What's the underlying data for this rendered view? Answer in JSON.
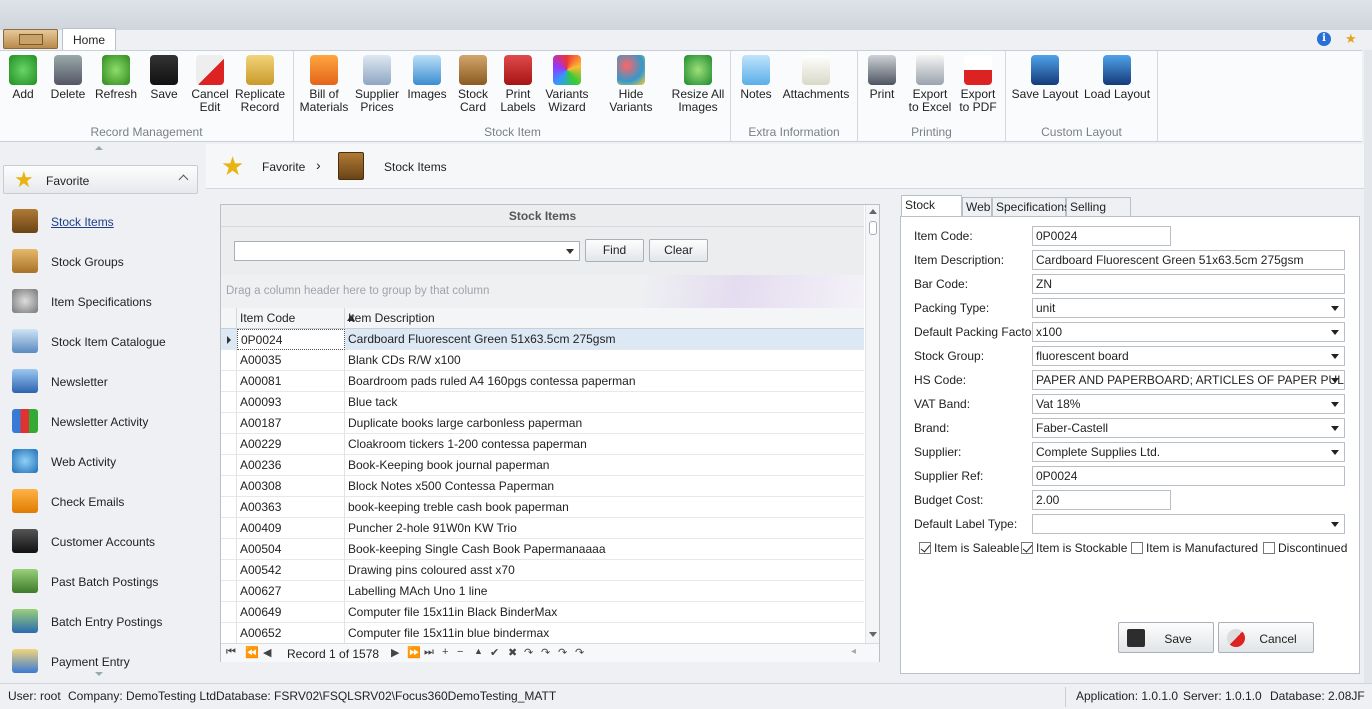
{
  "ribbon": {
    "home_tab": "Home",
    "groups": [
      {
        "caption": "Record Management",
        "buttons": [
          "Add",
          "Delete",
          "Refresh",
          "Save",
          "Cancel\nEdit",
          "Replicate\nRecord"
        ]
      },
      {
        "caption": "Stock Item",
        "buttons": [
          "Bill of\nMaterials",
          "Supplier\nPrices",
          "Images",
          "Stock\nCard",
          "Print\nLabels",
          "Variants\nWizard",
          "Hide Variants",
          "Resize All\nImages"
        ]
      },
      {
        "caption": "Extra Information",
        "buttons": [
          "Notes",
          "Attachments"
        ]
      },
      {
        "caption": "Printing",
        "buttons": [
          "Print",
          "Export\nto Excel",
          "Export\nto PDF"
        ]
      },
      {
        "caption": "Custom Layout",
        "buttons": [
          "Save Layout",
          "Load Layout"
        ]
      }
    ],
    "info_glyph": "i"
  },
  "nav": {
    "favorite_label": "Favorite",
    "items": [
      {
        "label": "Stock Items",
        "icon": "stock-items-icon",
        "active": true
      },
      {
        "label": "Stock Groups",
        "icon": "stock-groups-icon"
      },
      {
        "label": "Item Specifications",
        "icon": "gear-icon"
      },
      {
        "label": "Stock Item Catalogue",
        "icon": "catalogue-icon"
      },
      {
        "label": "Newsletter",
        "icon": "newsletter-icon"
      },
      {
        "label": "Newsletter Activity",
        "icon": "chart-icon"
      },
      {
        "label": "Web Activity",
        "icon": "globe-icon"
      },
      {
        "label": "Check Emails",
        "icon": "envelope-icon"
      },
      {
        "label": "Customer Accounts",
        "icon": "people-icon"
      },
      {
        "label": "Past Batch Postings",
        "icon": "batch-icon"
      },
      {
        "label": "Batch Entry Postings",
        "icon": "batch-entry-icon"
      },
      {
        "label": "Payment Entry",
        "icon": "payment-icon"
      }
    ]
  },
  "breadcrumb": {
    "first": "Favorite",
    "separator": "›",
    "second": "Stock Items"
  },
  "grid": {
    "title": "Stock Items",
    "find_label": "Find",
    "clear_label": "Clear",
    "group_hint": "Drag a column header here to group by that column",
    "columns": [
      "Item Code",
      "Item Description"
    ],
    "rows": [
      [
        "0P0024",
        "Cardboard Fluorescent Green 51x63.5cm 275gsm"
      ],
      [
        "A00035",
        "Blank CDs R/W x100"
      ],
      [
        "A00081",
        "Boardroom pads ruled A4 160pgs contessa paperman"
      ],
      [
        "A00093",
        "Blue tack"
      ],
      [
        "A00187",
        "Duplicate  books large carbonless paperman"
      ],
      [
        "A00229",
        "Cloakroom tickers 1-200 contessa paperman"
      ],
      [
        "A00236",
        "Book-Keeping book journal paperman"
      ],
      [
        "A00308",
        "Block Notes x500 Contessa Paperman"
      ],
      [
        "A00363",
        "book-keeping treble cash book paperman"
      ],
      [
        "A00409",
        "Puncher 2-hole 91W0n KW Trio"
      ],
      [
        "A00504",
        "Book-keeping Single Cash Book Papermanaaaa"
      ],
      [
        "A00542",
        "Drawing pins coloured asst x70"
      ],
      [
        "A00627",
        "Labelling MAch Uno 1 line"
      ],
      [
        "A00649",
        "Computer file 15x11in Black BinderMax"
      ],
      [
        "A00652",
        "Computer file 15x11in blue bindermax"
      ]
    ],
    "record_label": "Record 1 of 1578",
    "nav_glyphs": [
      "⏮",
      "⏪",
      "◀",
      "▶",
      "⏩",
      "⏭",
      "+",
      "−",
      "▲",
      "✔",
      "✖",
      "↷",
      "↷",
      "↷",
      "↷"
    ]
  },
  "detail": {
    "tabs": [
      "Stock Item",
      "Web",
      "Specifications",
      "Selling Price"
    ],
    "fields": [
      {
        "label": "Item Code:",
        "value": "0P0024",
        "type": "text",
        "short": true
      },
      {
        "label": "Item Description:",
        "value": "Cardboard Fluorescent Green 51x63.5cm 275gsm",
        "type": "text"
      },
      {
        "label": "Bar Code:",
        "value": "ZN",
        "type": "text"
      },
      {
        "label": "Packing Type:",
        "value": "unit",
        "type": "select"
      },
      {
        "label": "Default Packing Factor:",
        "value": "x100",
        "type": "select"
      },
      {
        "label": "Stock Group:",
        "value": "fluorescent board",
        "type": "select"
      },
      {
        "label": "HS Code:",
        "value": "PAPER AND PAPERBOARD; ARTICLES OF PAPER PULP, O...",
        "type": "select"
      },
      {
        "label": "VAT Band:",
        "value": "Vat 18%",
        "type": "select"
      },
      {
        "label": "Brand:",
        "value": "Faber-Castell",
        "type": "select"
      },
      {
        "label": "Supplier:",
        "value": "Complete Supplies Ltd.",
        "type": "select"
      },
      {
        "label": "Supplier Ref:",
        "value": "0P0024",
        "type": "text"
      },
      {
        "label": "Budget Cost:",
        "value": "2.00",
        "type": "text",
        "short": true
      },
      {
        "label": "Default Label Type:",
        "value": "",
        "type": "select"
      }
    ],
    "checkboxes": [
      {
        "label": "Item is Saleable",
        "checked": true
      },
      {
        "label": "Item is Stockable",
        "checked": true
      },
      {
        "label": "Item is Manufactured",
        "checked": false
      },
      {
        "label": "Discontinued",
        "checked": false
      }
    ],
    "save_label": "Save",
    "cancel_label": "Cancel"
  },
  "status": {
    "user": "User: root",
    "company": "Company: DemoTesting Ltd.",
    "database": "Database: FSRV02\\FSQLSRV02\\Focus360DemoTesting_MATT",
    "application": "Application: 1.0.1.0",
    "server": "Server: 1.0.1.0",
    "db_version": "Database: 2.08JF"
  },
  "colors": {
    "accent": "#2a6fd6",
    "selection": "#dde8f5",
    "star": "#e8b313"
  }
}
